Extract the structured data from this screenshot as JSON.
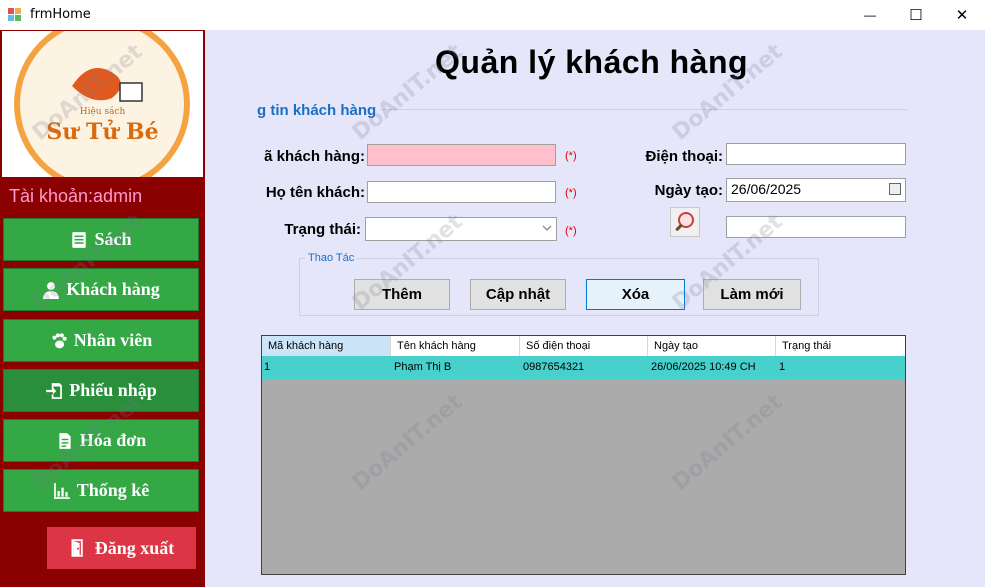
{
  "window": {
    "title": "frmHome",
    "minimize_glyph": "—",
    "maximize_glyph": "☐",
    "close_glyph": "✕"
  },
  "sidebar": {
    "logo": {
      "brand_top": "Hiệu sách",
      "brand_name": "Sư Tử Bé"
    },
    "account_label": "Tài khoản:admin",
    "items": [
      {
        "label": "Sách",
        "icon": "book-icon"
      },
      {
        "label": "Khách hàng",
        "icon": "user-icon"
      },
      {
        "label": "Nhân viên",
        "icon": "paw-icon"
      },
      {
        "label": "Phiếu nhập",
        "icon": "import-icon"
      },
      {
        "label": "Hóa đơn",
        "icon": "invoice-icon"
      },
      {
        "label": "Thống kê",
        "icon": "chart-icon"
      }
    ],
    "logout_label": "Đăng xuất"
  },
  "main": {
    "page_title": "Quản lý khách hàng",
    "section_label": "g tin khách hàng",
    "fields": {
      "customer_id_label": "ã khách hàng:",
      "customer_id_value": "",
      "full_name_label": "Họ tên khách:",
      "full_name_value": "",
      "status_label": "Trạng thái:",
      "status_value": "",
      "phone_label": "Điện thoại:",
      "phone_value": "",
      "created_label": "Ngày tạo:",
      "created_value": "26/06/2025",
      "search_value": "",
      "required_mark": "(*)"
    },
    "actions": {
      "legend": "Thao Tác",
      "add_label": "Thêm",
      "update_label": "Cập nhật",
      "delete_label": "Xóa",
      "refresh_label": "Làm mới"
    },
    "grid": {
      "columns": [
        "Mã khách hàng",
        "Tên khách hàng",
        "Số điện thoại",
        "Ngày tạo",
        "Trạng thái"
      ],
      "rows": [
        [
          "1",
          "Phạm Thị B",
          "0987654321",
          "26/06/2025 10:49 CH",
          "1"
        ]
      ]
    }
  },
  "colors": {
    "sidebar_bg": "#8b0000",
    "nav_button": "#33a845",
    "logout_button": "#dc3545",
    "main_bg": "#e6e6fa",
    "selected_row": "#48d1cc",
    "required_field": "#ffc0cb",
    "section_text": "#1a6fc4"
  },
  "watermark": "DoAnIT.net"
}
